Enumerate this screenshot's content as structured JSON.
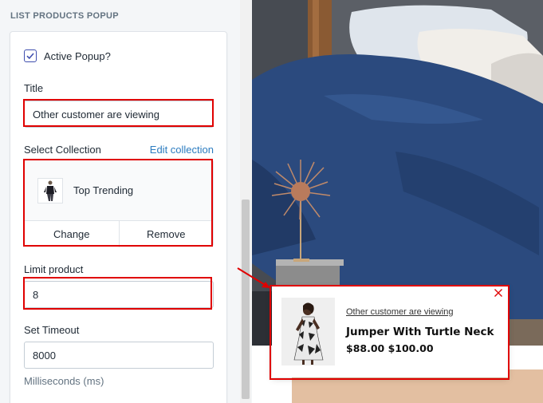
{
  "panel": {
    "section_heading": "LIST PRODUCTS POPUP",
    "active_popup_label": "Active Popup?",
    "active_popup_checked": true,
    "title_label": "Title",
    "title_value": "Other customer are viewing",
    "collection_label": "Select Collection",
    "edit_collection_link": "Edit collection",
    "collection_name": "Top Trending",
    "change_button": "Change",
    "remove_button": "Remove",
    "limit_label": "Limit product",
    "limit_value": "8",
    "timeout_label": "Set Timeout",
    "timeout_value": "8000",
    "timeout_help": "Milliseconds (ms)"
  },
  "popup": {
    "caption": "Other customer are viewing",
    "product_title": "Jumper With Turtle Neck",
    "price": "$88.00 $100.00"
  },
  "colors": {
    "highlight": "#e00000",
    "link": "#2c7cc0",
    "checkbox": "#3f4eae",
    "bedding": "#2b4a7e"
  },
  "icons": {
    "checkbox": "checkmark-icon",
    "close": "close-icon",
    "arrow": "pointer-arrow-icon"
  }
}
